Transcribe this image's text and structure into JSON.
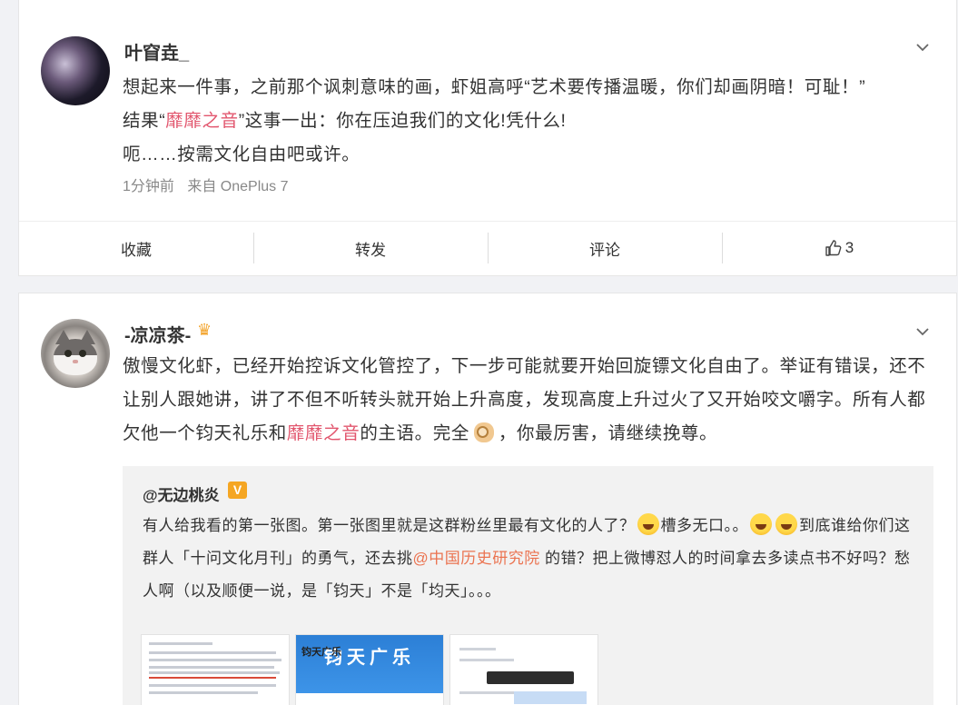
{
  "post1": {
    "username": "叶窅垚_",
    "text_line1": "想起来一件事，之前那个讽刺意味的画，虾姐高呼“艺术要传播温暖，你们却画阴暗！可耻！”",
    "text_line2_pre": "结果“",
    "topic": "靡靡之音",
    "text_line2_post": "”这事一出：你在压迫我们的文化!凭什么!",
    "text_line3": "呃……按需文化自由吧或许。",
    "time": "1分钟前",
    "source": "来自 OnePlus 7",
    "actions": {
      "favorite": "收藏",
      "repost": "转发",
      "comment": "评论",
      "like_count": "3"
    }
  },
  "post2": {
    "username": "-凉凉茶-",
    "text_part1": "傲慢文化虾，已经开始控诉文化管控了，下一步可能就要开始回旋镖文化自由了。举证有错误，还不让别人跟她讲，讲了不但不听转头就开始上升高度，发现高度上升过火了又开始咬文嚼字。所有人都欠他一个钧天礼乐和",
    "topic": "靡靡之音",
    "text_part2": "的主语。完全",
    "text_part3": "，你最厉害，请继续挽尊。",
    "repost": {
      "username": "@无边桃炎",
      "vip_label": "V",
      "text_part1": "有人给我看的第一张图。第一张图里就是这群粉丝里最有文化的人了？",
      "text_part2": "槽多无口。。",
      "text_part3": "到底谁给你们这群人「十问文化月刊」的勇气，还去挑",
      "mention": "@中国历史研究院",
      "text_part4": " 的错？把上微博怼人的时间拿去多读点书不好吗？愁人啊（以及顺便一说，是「钧天」不是「均天」。。。",
      "image2_title": "钧天广乐",
      "image2_subtitle": "钧天广乐"
    }
  },
  "colors": {
    "topic": "#e2566e",
    "link": "#eb7350",
    "vip": "#f5a623"
  }
}
